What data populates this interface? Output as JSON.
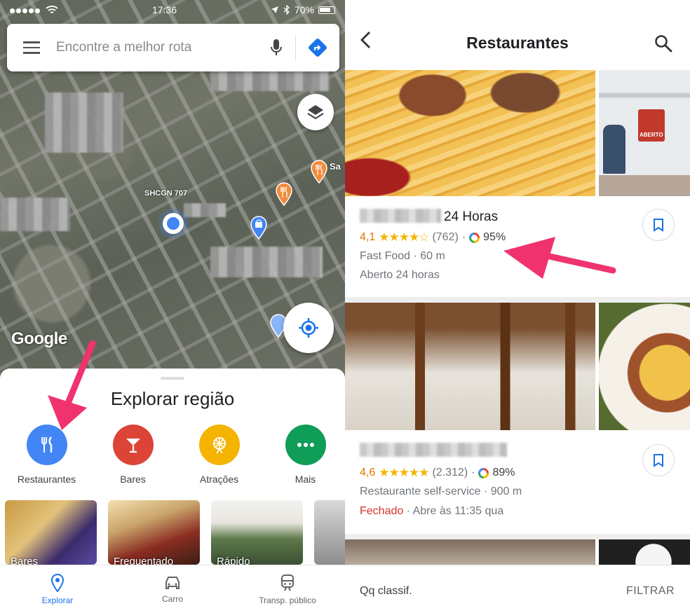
{
  "left": {
    "status": {
      "time": "17:36",
      "battery": "70%"
    },
    "search": {
      "placeholder": "Encontre a melhor rota"
    },
    "map": {
      "google_label": "Google",
      "street_label": "SHCGN 707",
      "poi_label": "Sa"
    },
    "explore": {
      "title": "Explorar região",
      "categories": [
        {
          "label": "Restaurantes",
          "color": "#4285f4",
          "icon": "fork-knife-icon"
        },
        {
          "label": "Bares",
          "color": "#db4437",
          "icon": "cocktail-icon"
        },
        {
          "label": "Atrações",
          "color": "#f4b400",
          "icon": "ferris-wheel-icon"
        },
        {
          "label": "Mais",
          "color": "#0f9d58",
          "icon": "more-dots-icon"
        }
      ],
      "thumbnails": [
        "Bares",
        "Frequentado",
        "Rápido",
        ""
      ]
    },
    "nav": [
      {
        "label": "Explorar",
        "icon": "explore-pin-icon",
        "active": true
      },
      {
        "label": "Carro",
        "icon": "car-icon",
        "active": false
      },
      {
        "label": "Transp. público",
        "icon": "train-icon",
        "active": false
      }
    ]
  },
  "right": {
    "title": "Restaurantes",
    "results": [
      {
        "name_suffix": "24 Horas",
        "rating": "4,1",
        "stars": "★★★★☆",
        "reviews": "(762)",
        "match": "95%",
        "category_distance": "Fast Food · 60 m",
        "hours": "Aberto 24 horas",
        "status_closed": ""
      },
      {
        "name_suffix": "",
        "rating": "4,6",
        "stars": "★★★★★",
        "reviews": "(2.312)",
        "match": "89%",
        "category_distance": "Restaurante self-service · 900 m",
        "hours": " · Abre às 11:35 qua",
        "status_closed": "Fechado"
      }
    ],
    "footer": {
      "sort": "Qq classif.",
      "filter": "FILTRAR"
    },
    "photo_sign": "ABERTO"
  },
  "colors": {
    "accent_blue": "#1a73e8",
    "arrow_pink": "#f0336e",
    "star_yellow": "#f4b400",
    "rating_orange": "#e37400",
    "closed_red": "#d93025"
  }
}
